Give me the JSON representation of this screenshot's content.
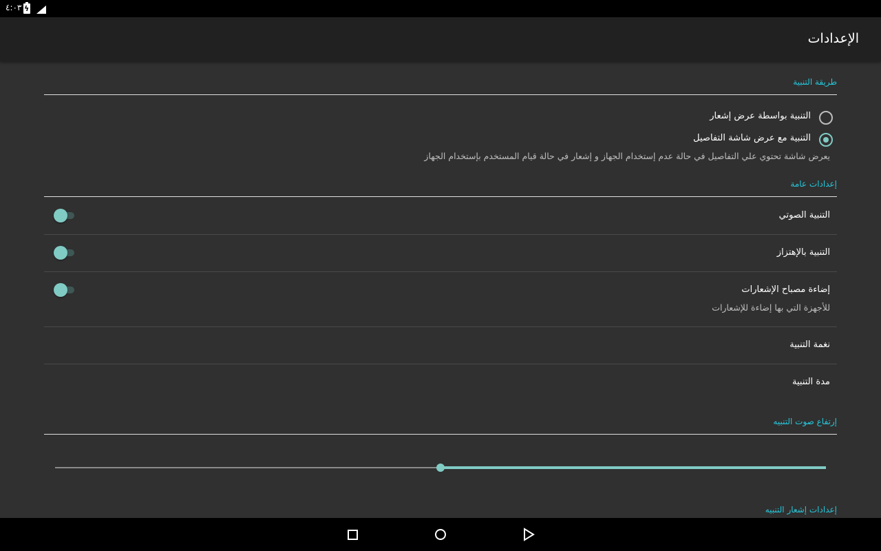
{
  "status_bar": {
    "time": "٤:٠٣",
    "icons": [
      "battery-charging-icon",
      "signal-icon"
    ]
  },
  "app_bar": {
    "title": "الإعدادات"
  },
  "alert_method": {
    "category": "طريقة التنبية",
    "options": [
      {
        "label": "التنبية بواسطة عرض إشعار",
        "checked": false
      },
      {
        "label": "التنبية مع عرض شاشة التفاصيل",
        "checked": true
      }
    ],
    "summary": "يعرض شاشة تحتوي علي التفاصيل في حالة عدم إستخدام الجهاز و إشعار في حالة قيام المستخدم بإستخدام الجهاز"
  },
  "general": {
    "category": "إعدادات عامة",
    "sound": {
      "title": "التنبية الصوتي",
      "on": false
    },
    "vibrate": {
      "title": "التنبية بالإهتزاز",
      "on": false
    },
    "light": {
      "title": "إضاءة مصباح الإشعارات",
      "summary": "للأجهزة التي بها إضاءة للإشعارات",
      "on": false
    },
    "ringtone": {
      "title": "نغمة التنبية"
    },
    "duration": {
      "title": "مدة التنبية"
    }
  },
  "volume": {
    "category": "إرتفاع صوت التنبيه",
    "level": 0.5
  },
  "notification": {
    "category": "إعدادات إشعار التنبيه"
  },
  "nav_bar": {
    "icons": [
      "recents-square-icon",
      "home-circle-icon",
      "back-triangle-icon"
    ]
  },
  "colors": {
    "accent": "#26c6da",
    "switch": "#80cbc4",
    "background": "#303030",
    "toolbar": "#212121"
  }
}
